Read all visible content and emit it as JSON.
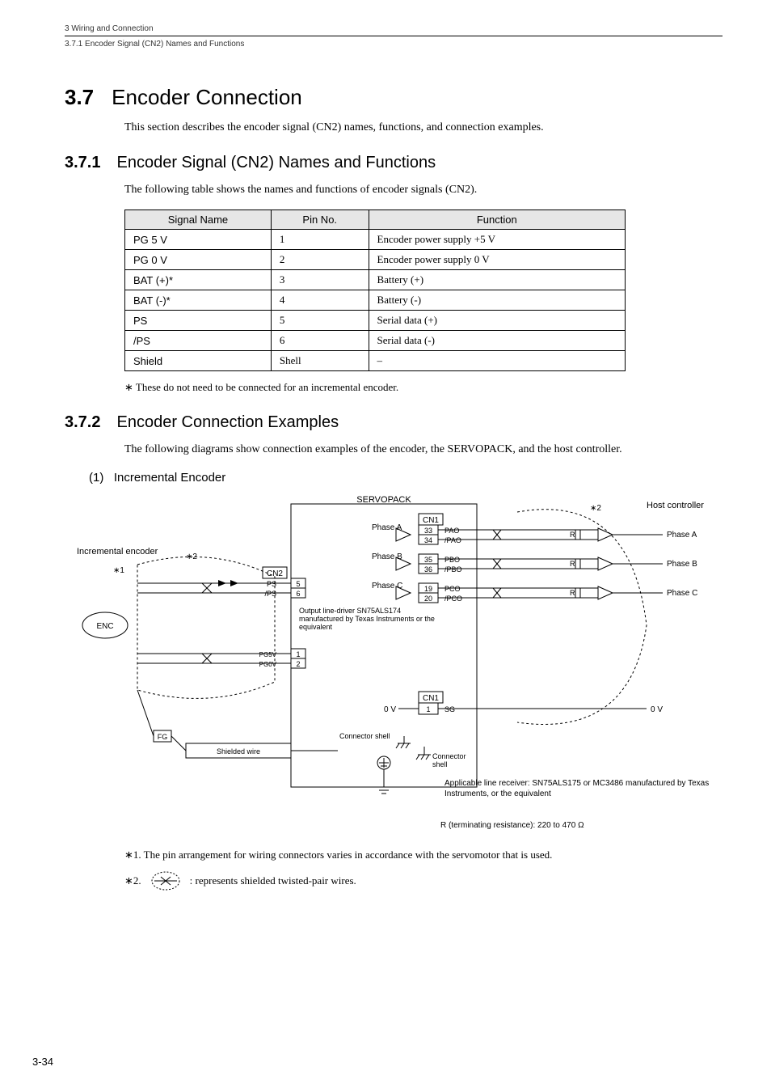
{
  "header": {
    "chapter_line": "3  Wiring and Connection",
    "section_line": "3.7.1  Encoder Signal (CN2) Names and Functions"
  },
  "sec37": {
    "num": "3.7",
    "title": "Encoder Connection",
    "intro": "This section describes the encoder signal (CN2) names, functions, and connection examples."
  },
  "sec371": {
    "num": "3.7.1",
    "title": "Encoder Signal (CN2) Names and Functions",
    "intro": "The following table shows the names and functions of encoder signals (CN2).",
    "table": {
      "headers": [
        "Signal Name",
        "Pin No.",
        "Function"
      ],
      "rows": [
        {
          "name": "PG 5 V",
          "pin": "1",
          "func": "Encoder power supply +5 V"
        },
        {
          "name": "PG 0 V",
          "pin": "2",
          "func": "Encoder power supply 0 V"
        },
        {
          "name": "BAT (+)*",
          "pin": "3",
          "func": "Battery (+)"
        },
        {
          "name": "BAT (-)*",
          "pin": "4",
          "func": "Battery (-)"
        },
        {
          "name": "PS",
          "pin": "5",
          "func": "Serial data (+)"
        },
        {
          "name": "/PS",
          "pin": "6",
          "func": "Serial data (-)"
        },
        {
          "name": "Shield",
          "pin": "Shell",
          "func": "–"
        }
      ]
    },
    "footnote": "∗   These do not need to be connected for an incremental encoder."
  },
  "sec372": {
    "num": "3.7.2",
    "title": "Encoder Connection Examples",
    "intro": "The following diagrams show connection examples of the encoder, the SERVOPACK, and the host controller.",
    "sub1": {
      "label": "(1)",
      "title": "Incremental Encoder"
    }
  },
  "diagram": {
    "labels": {
      "servopack": "SERVOPACK",
      "host_controller": "Host controller",
      "incremental_encoder": "Incremental encoder",
      "enc": "ENC",
      "fg": "FG",
      "shielded_wire": "Shielded wire",
      "connector_shell": "Connector shell",
      "connector_shell2": "Connector\nshell",
      "output_driver": "Output line-driver SN75ALS174 manufactured by Texas Instruments or the equivalent",
      "line_receiver": "Applicable line receiver: SN75ALS175 or MC3486 manufactured by Texas Instruments, or the equivalent",
      "terminating": "R (terminating resistance): 220 to 470 Ω",
      "phase_a": "Phase A",
      "phase_b": "Phase B",
      "phase_c": "Phase C",
      "cn1": "CN1",
      "cn2": "CN2",
      "ps": "PS",
      "nps": "/PS",
      "pg5v": "PG5V",
      "pg0v": "PG0V",
      "zero_v": "0 V",
      "sg": "SG",
      "r": "R",
      "star1": "∗1",
      "star2": "∗2"
    },
    "pins": {
      "pao": "PAO",
      "npao": "/PAO",
      "pbo": "PBO",
      "npbo": "/PBO",
      "pco": "PCO",
      "npco": "/PCO",
      "p33": "33",
      "p34": "34",
      "p35": "35",
      "p36": "36",
      "p19": "19",
      "p20": "20",
      "p5": "5",
      "p6": "6",
      "p1": "1",
      "p2": "2",
      "cn1_p1": "1"
    }
  },
  "footnotes": {
    "fn1": "∗1.   The pin arrangement for wiring connectors varies in accordance with the servomotor that is used.",
    "fn2_prefix": "∗2.",
    "fn2_text": ": represents shielded twisted-pair wires."
  },
  "page_number": "3-34",
  "chart_data": [
    {
      "type": "table",
      "title": "Encoder Signal (CN2) Names and Functions",
      "columns": [
        "Signal Name",
        "Pin No.",
        "Function"
      ],
      "rows": [
        [
          "PG 5 V",
          "1",
          "Encoder power supply +5 V"
        ],
        [
          "PG 0 V",
          "2",
          "Encoder power supply 0 V"
        ],
        [
          "BAT (+)*",
          "3",
          "Battery (+)"
        ],
        [
          "BAT (-)*",
          "4",
          "Battery (-)"
        ],
        [
          "PS",
          "5",
          "Serial data (+)"
        ],
        [
          "/PS",
          "6",
          "Serial data (-)"
        ],
        [
          "Shield",
          "Shell",
          "–"
        ]
      ]
    }
  ]
}
